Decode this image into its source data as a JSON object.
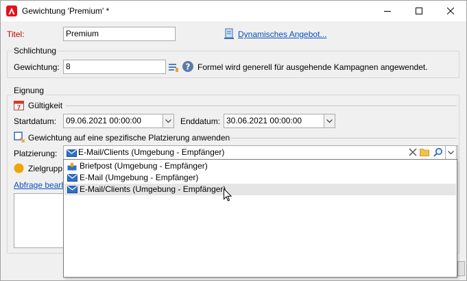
{
  "window": {
    "title": "Gewichtung 'Premium' *"
  },
  "header": {
    "title_label": "Titel:",
    "title_value": "Premium",
    "dynamic_offer_link": "Dynamisches Angebot..."
  },
  "arbitration": {
    "section_label": "Schlichtung",
    "weight_label": "Gewichtung:",
    "weight_value": "8",
    "help_text": "Formel wird generell für ausgehende Kampagnen angewendet."
  },
  "eligibility": {
    "section_label": "Eignung",
    "validity_label": "Gültigkeit",
    "start_label": "Startdatum:",
    "start_value": "09.06.2021 00:00:00",
    "end_label": "Enddatum:",
    "end_value": "30.06.2021 00:00:00",
    "placement_checkbox_label": "Gewichtung auf eine spezifische Platzierung anwenden",
    "placement_label": "Platzierung:",
    "placement_value": "E-Mail/Clients (Umgebung - Empfänger)",
    "target_label": "Zielgrupp",
    "edit_query_link": "Abfrage bearb"
  },
  "dropdown": {
    "items": [
      {
        "label": "Briefpost (Umgebung - Empfänger)",
        "icon": "mail-post-icon",
        "selected": false
      },
      {
        "label": "E-Mail (Umgebung - Empfänger)",
        "icon": "envelope-icon",
        "selected": false
      },
      {
        "label": "E-Mail/Clients (Umgebung - Empfänger)",
        "icon": "envelope-icon",
        "selected": true
      }
    ]
  },
  "colors": {
    "accent_red": "#e3131b",
    "link_blue": "#0b4fbf",
    "required_red": "#c00000"
  }
}
